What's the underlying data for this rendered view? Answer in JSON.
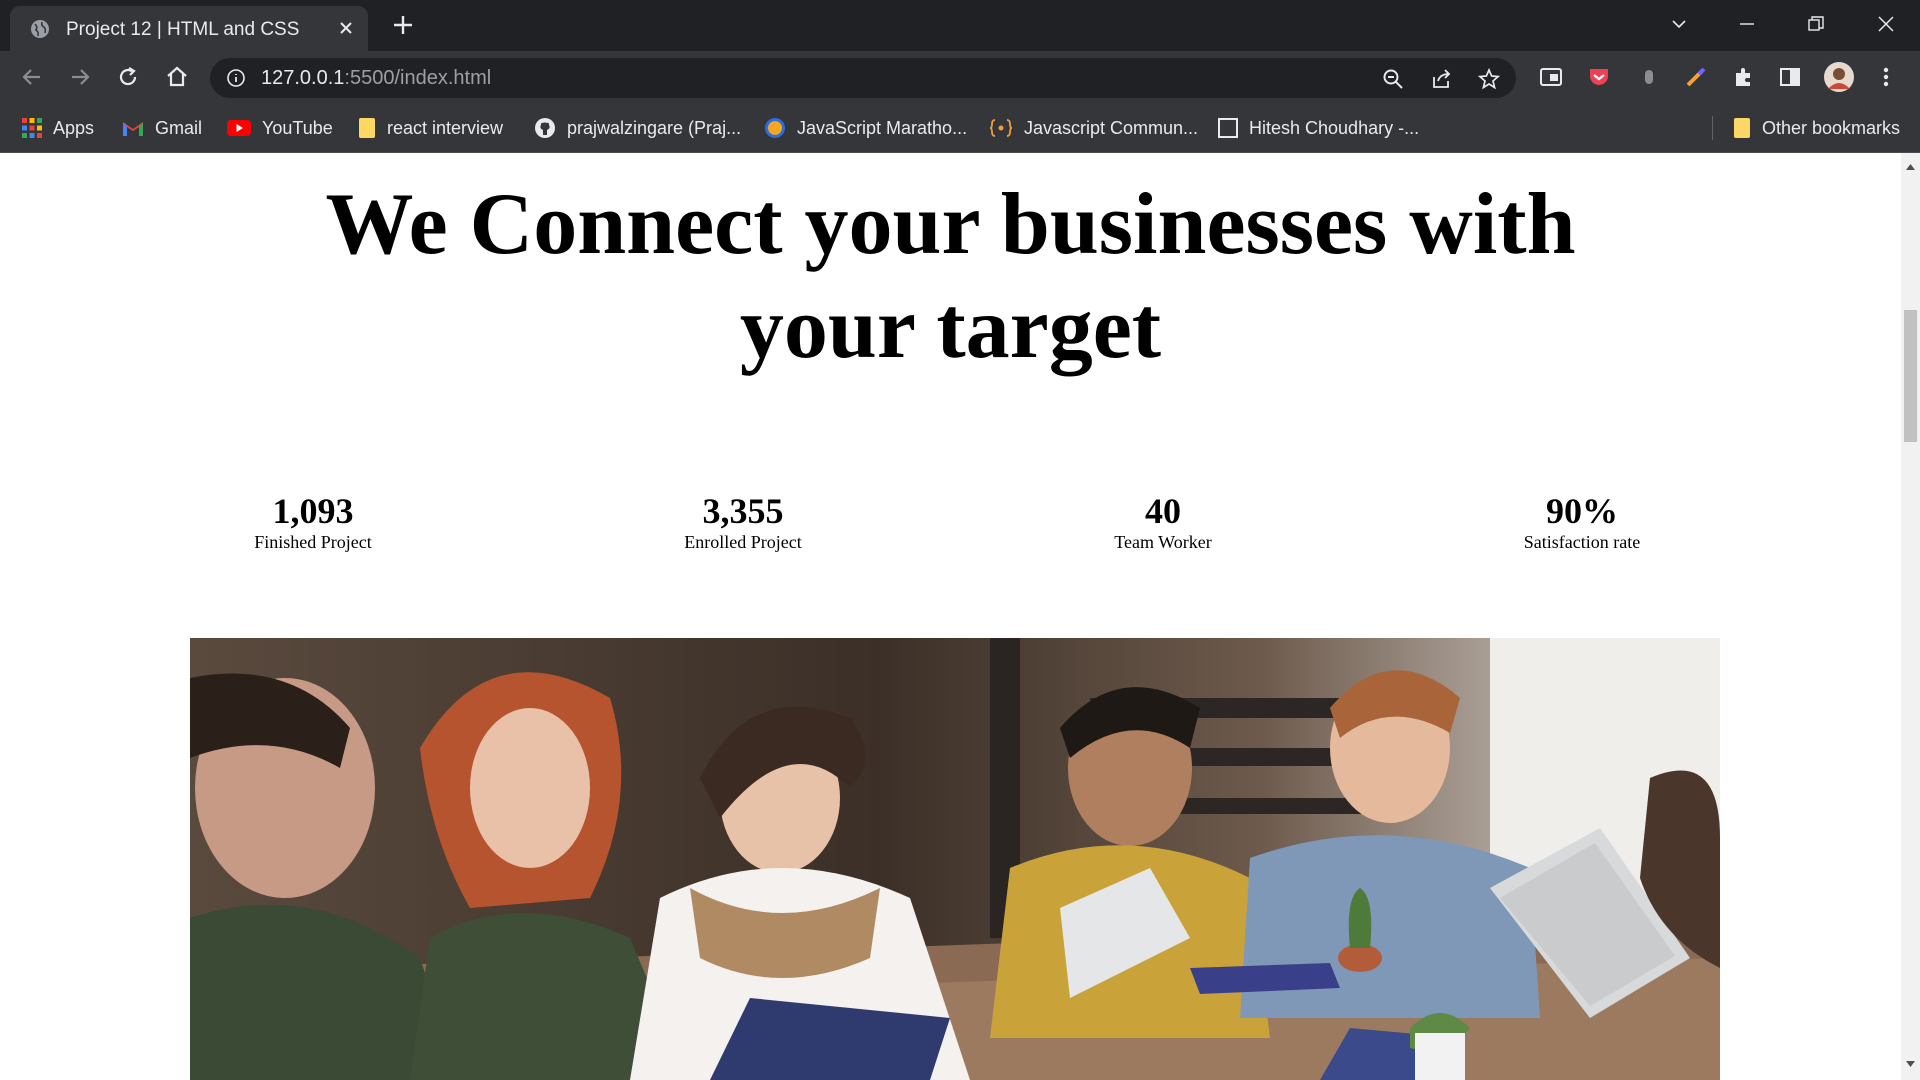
{
  "browser": {
    "tab_title": "Project 12 | HTML and CSS",
    "url_host": "127.0.0.1",
    "url_path": ":5500/index.html",
    "bookmarks": [
      {
        "label": "Apps",
        "icon": "apps-grid-icon"
      },
      {
        "label": "Gmail",
        "icon": "gmail-icon"
      },
      {
        "label": "YouTube",
        "icon": "youtube-icon"
      },
      {
        "label": "react interview",
        "icon": "folder-icon"
      },
      {
        "label": "prajwalzingare (Praj...",
        "icon": "github-icon"
      },
      {
        "label": "JavaScript Maratho...",
        "icon": "site-icon"
      },
      {
        "label": "Javascript Commun...",
        "icon": "braces-icon"
      },
      {
        "label": "Hitesh Choudhary -...",
        "icon": "page-icon"
      }
    ],
    "other_bookmarks": "Other bookmarks"
  },
  "hero": {
    "title_line1": "We Connect your businesses with",
    "title_line2": "your target"
  },
  "stats": [
    {
      "value": "1,093",
      "label": "Finished Project"
    },
    {
      "value": "3,355",
      "label": "Enrolled Project"
    },
    {
      "value": "40",
      "label": "Team Worker"
    },
    {
      "value": "90%",
      "label": "Satisfaction rate"
    }
  ],
  "colors": {
    "chrome_dark": "#202124",
    "chrome_mid": "#35363a",
    "page_bg": "#ffffff",
    "text": "#000000"
  }
}
